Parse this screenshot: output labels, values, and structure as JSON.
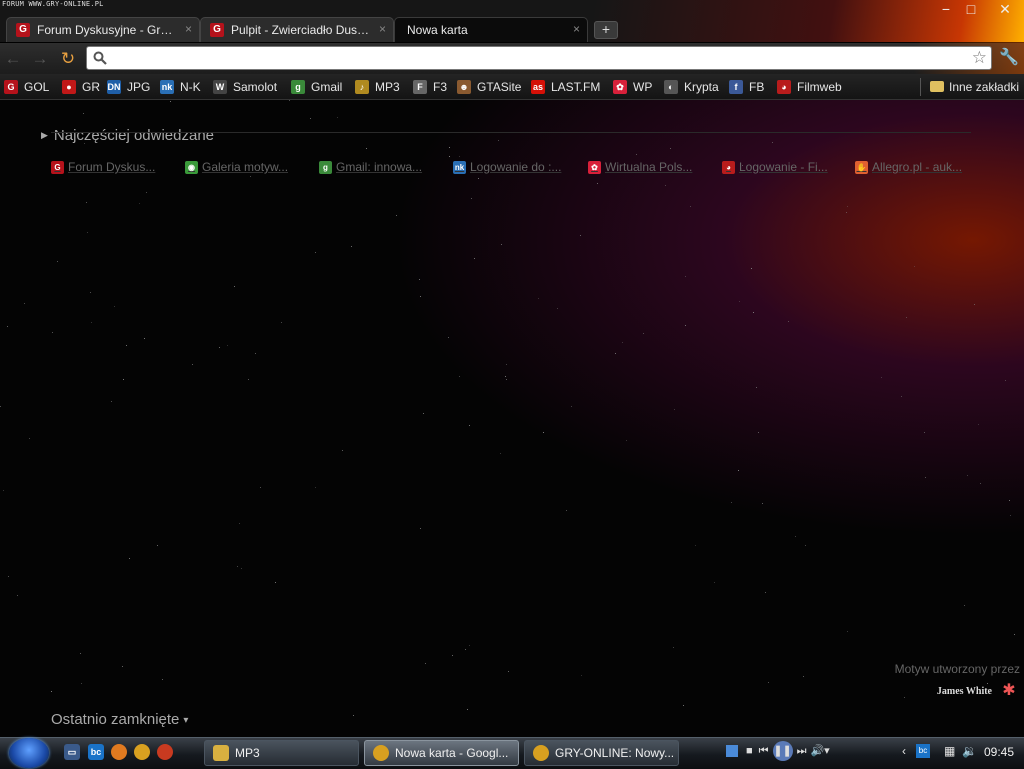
{
  "watermark": "FORUM WWW.GRY-ONLINE.PL",
  "window": {
    "minimize": "−",
    "maximize": "□",
    "close": "✕"
  },
  "tabs": [
    {
      "label": "Forum Dyskusyjne - Gry-Online",
      "favicon": "G",
      "close": "×"
    },
    {
      "label": "Pulpit - Zwierciadło Dusz...",
      "favicon": "G",
      "close": "×"
    },
    {
      "label": "Nowa karta",
      "close": "×"
    }
  ],
  "new_tab_symbol": "+",
  "toolbar": {
    "back": "←",
    "forward": "→",
    "reload": "↻",
    "omnibox_value": "",
    "star": "☆",
    "wrench": "🔧"
  },
  "bookmarks": [
    {
      "label": "GOL",
      "icon": "G",
      "color": "#b5121b"
    },
    {
      "label": "GR",
      "icon": "●",
      "color": "#c01818"
    },
    {
      "label": "JPG",
      "icon": "DN",
      "color": "#1f5fa8"
    },
    {
      "label": "N-K",
      "icon": "nk",
      "color": "#2a6fb5"
    },
    {
      "label": "Samolot",
      "icon": "W",
      "color": "#444444"
    },
    {
      "label": "Gmail",
      "icon": "g",
      "color": "#3a8a3a"
    },
    {
      "label": "MP3",
      "icon": "♪",
      "color": "#b08a20"
    },
    {
      "label": "F3",
      "icon": "F",
      "color": "#666666"
    },
    {
      "label": "GTASite",
      "icon": "☻",
      "color": "#8a5a30"
    },
    {
      "label": "LAST.FM",
      "icon": "as",
      "color": "#d51007"
    },
    {
      "label": "WP",
      "icon": "✿",
      "color": "#d8203a"
    },
    {
      "label": "Krypta",
      "icon": "◐",
      "color": "#555555"
    },
    {
      "label": "FB",
      "icon": "f",
      "color": "#3b5998"
    },
    {
      "label": "Filmweb",
      "icon": "◕",
      "color": "#b81c1c"
    }
  ],
  "other_bookmarks": {
    "label": "Inne zakładki",
    "icon": "folder-icon"
  },
  "most_visited": {
    "title": "Najczęściej odwiedzane",
    "items": [
      {
        "label": "Forum Dyskus...",
        "icon": "G",
        "color": "#b5121b"
      },
      {
        "label": "Galeria motyw...",
        "icon": "◉",
        "color": "#3a9a3a"
      },
      {
        "label": "Gmail: innowa...",
        "icon": "g",
        "color": "#3a8a3a"
      },
      {
        "label": "Logowanie do :...",
        "icon": "nk",
        "color": "#2a6fb5"
      },
      {
        "label": "Wirtualna Pols...",
        "icon": "✿",
        "color": "#d8203a"
      },
      {
        "label": "Logowanie - Fi...",
        "icon": "◕",
        "color": "#b81c1c"
      },
      {
        "label": "Allegro.pl - auk...",
        "icon": "✋",
        "color": "#e06030"
      }
    ]
  },
  "theme": {
    "credit": "Motyw utworzony przez",
    "author": "James White"
  },
  "recently_closed": {
    "label": "Ostatnio zamknięte",
    "arrow": "▾"
  },
  "taskbar": {
    "tasks": [
      {
        "label": "MP3",
        "icon": "folder-icon",
        "color": "#d8b040"
      },
      {
        "label": "Nowa karta - Googl...",
        "icon": "chrome-icon",
        "color": "#d8a020"
      },
      {
        "label": "GRY-ONLINE: Nowy...",
        "icon": "chrome-icon",
        "color": "#d8a020"
      }
    ],
    "clock": "09:45"
  }
}
